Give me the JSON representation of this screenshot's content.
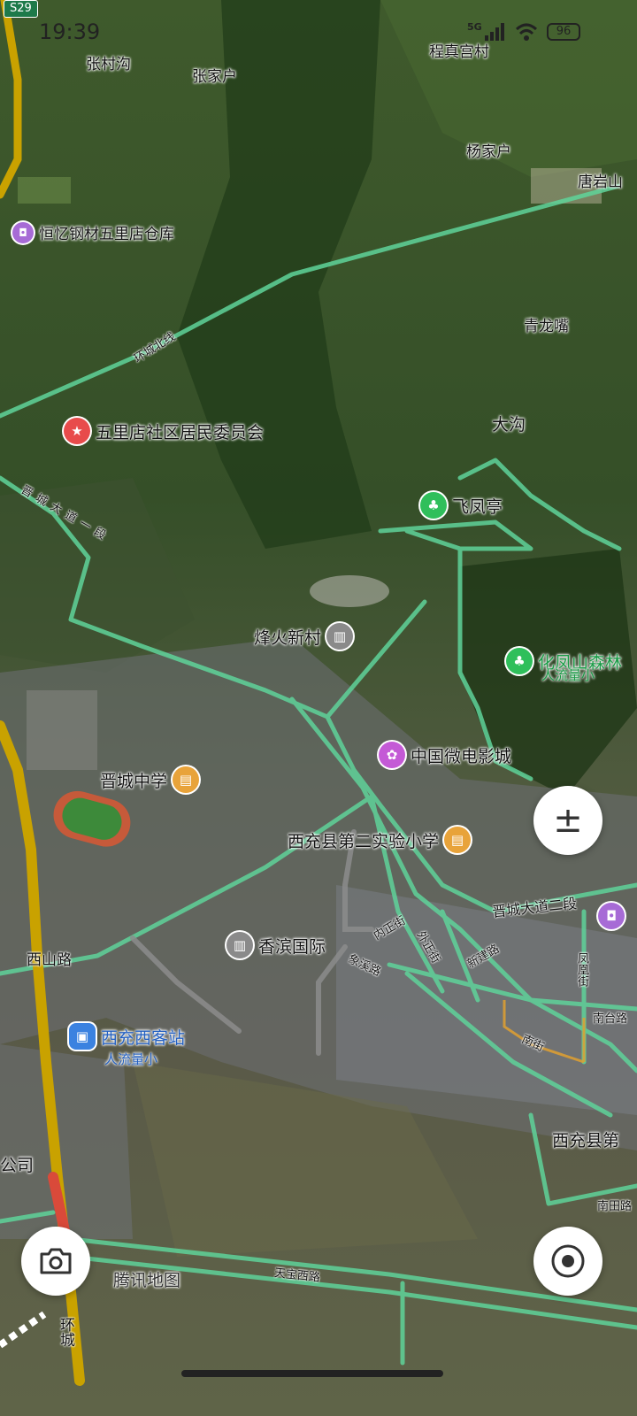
{
  "status_bar": {
    "time": "19:39",
    "network": "5G",
    "battery": "96",
    "highway_shield": "S29"
  },
  "places": {
    "zhangcungou": "张村沟",
    "zhangjiahu": "张家户",
    "chengzhengongcun": "程真宫村",
    "yangjiahu": "杨家户",
    "tangyanshan": "唐岩山",
    "qinglongzui": "青龙嘴",
    "dagou": "大沟"
  },
  "pois": {
    "hengyi": "恒忆钢材五里店仓库",
    "wulidian": "五里店社区居民委员会",
    "feifengting": "飞凤亭",
    "fenghuoxincun": "烽火新村",
    "huafengshan": "化凤山森林",
    "huafengshan_sub": "人流量小",
    "weidianying": "中国微电影城",
    "jinchengzhongxue": "晋城中学",
    "dier_shiyan": "西充县第二实验小学",
    "xiangbin": "香滨国际",
    "keyunzhan": "西充西客站",
    "keyunzhan_sub": "人流量小",
    "xichong_partial": "西充县第",
    "gongsi_partial": "公司"
  },
  "roads": {
    "huanchengbeixian": "环城北线",
    "jinchengdadao1": "晋城大道一段",
    "jinchengdadao2": "晋城大道二段",
    "xishanlu": "西山路",
    "neizhengjie": "内正街",
    "waizhengjie": "外正街",
    "xiangxilu": "象溪路",
    "xinjianlu": "新建路",
    "fenghuangjie": "凤凰街",
    "nantailu": "南台路",
    "nanjie": "南街",
    "nantianlu": "南田路",
    "tianbaoxilu": "天宝西路",
    "huancheng": "环城"
  },
  "watermark": "腾讯地图",
  "controls": {
    "zoom_symbol": "±",
    "camera_icon": "camera-icon",
    "locate_icon": "locate-icon"
  },
  "colors": {
    "road_green": "#5fd39a",
    "highway_yellow": "#c9a200",
    "poi_red": "#e84b4b",
    "poi_purple": "#a76bd6",
    "poi_green": "#2fbf5b",
    "poi_orange": "#e8a33a",
    "poi_gray": "#8a8a8a",
    "poi_blue": "#3b82e0"
  }
}
